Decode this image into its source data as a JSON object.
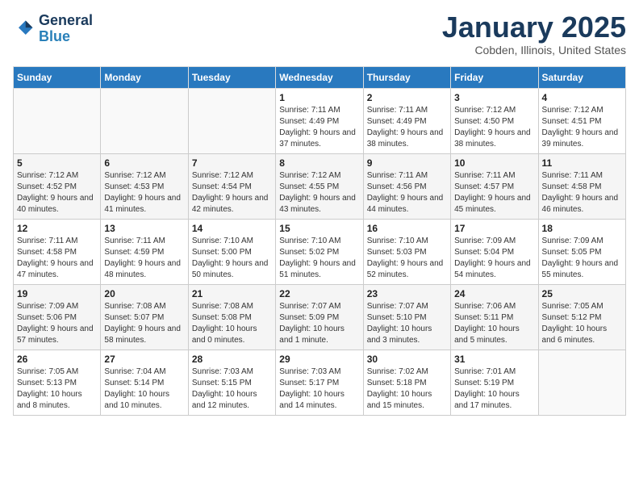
{
  "header": {
    "logo_line1": "General",
    "logo_line2": "Blue",
    "title": "January 2025",
    "subtitle": "Cobden, Illinois, United States"
  },
  "weekdays": [
    "Sunday",
    "Monday",
    "Tuesday",
    "Wednesday",
    "Thursday",
    "Friday",
    "Saturday"
  ],
  "weeks": [
    [
      {
        "day": "",
        "info": ""
      },
      {
        "day": "",
        "info": ""
      },
      {
        "day": "",
        "info": ""
      },
      {
        "day": "1",
        "info": "Sunrise: 7:11 AM\nSunset: 4:49 PM\nDaylight: 9 hours and 37 minutes."
      },
      {
        "day": "2",
        "info": "Sunrise: 7:11 AM\nSunset: 4:49 PM\nDaylight: 9 hours and 38 minutes."
      },
      {
        "day": "3",
        "info": "Sunrise: 7:12 AM\nSunset: 4:50 PM\nDaylight: 9 hours and 38 minutes."
      },
      {
        "day": "4",
        "info": "Sunrise: 7:12 AM\nSunset: 4:51 PM\nDaylight: 9 hours and 39 minutes."
      }
    ],
    [
      {
        "day": "5",
        "info": "Sunrise: 7:12 AM\nSunset: 4:52 PM\nDaylight: 9 hours and 40 minutes."
      },
      {
        "day": "6",
        "info": "Sunrise: 7:12 AM\nSunset: 4:53 PM\nDaylight: 9 hours and 41 minutes."
      },
      {
        "day": "7",
        "info": "Sunrise: 7:12 AM\nSunset: 4:54 PM\nDaylight: 9 hours and 42 minutes."
      },
      {
        "day": "8",
        "info": "Sunrise: 7:12 AM\nSunset: 4:55 PM\nDaylight: 9 hours and 43 minutes."
      },
      {
        "day": "9",
        "info": "Sunrise: 7:11 AM\nSunset: 4:56 PM\nDaylight: 9 hours and 44 minutes."
      },
      {
        "day": "10",
        "info": "Sunrise: 7:11 AM\nSunset: 4:57 PM\nDaylight: 9 hours and 45 minutes."
      },
      {
        "day": "11",
        "info": "Sunrise: 7:11 AM\nSunset: 4:58 PM\nDaylight: 9 hours and 46 minutes."
      }
    ],
    [
      {
        "day": "12",
        "info": "Sunrise: 7:11 AM\nSunset: 4:58 PM\nDaylight: 9 hours and 47 minutes."
      },
      {
        "day": "13",
        "info": "Sunrise: 7:11 AM\nSunset: 4:59 PM\nDaylight: 9 hours and 48 minutes."
      },
      {
        "day": "14",
        "info": "Sunrise: 7:10 AM\nSunset: 5:00 PM\nDaylight: 9 hours and 50 minutes."
      },
      {
        "day": "15",
        "info": "Sunrise: 7:10 AM\nSunset: 5:02 PM\nDaylight: 9 hours and 51 minutes."
      },
      {
        "day": "16",
        "info": "Sunrise: 7:10 AM\nSunset: 5:03 PM\nDaylight: 9 hours and 52 minutes."
      },
      {
        "day": "17",
        "info": "Sunrise: 7:09 AM\nSunset: 5:04 PM\nDaylight: 9 hours and 54 minutes."
      },
      {
        "day": "18",
        "info": "Sunrise: 7:09 AM\nSunset: 5:05 PM\nDaylight: 9 hours and 55 minutes."
      }
    ],
    [
      {
        "day": "19",
        "info": "Sunrise: 7:09 AM\nSunset: 5:06 PM\nDaylight: 9 hours and 57 minutes."
      },
      {
        "day": "20",
        "info": "Sunrise: 7:08 AM\nSunset: 5:07 PM\nDaylight: 9 hours and 58 minutes."
      },
      {
        "day": "21",
        "info": "Sunrise: 7:08 AM\nSunset: 5:08 PM\nDaylight: 10 hours and 0 minutes."
      },
      {
        "day": "22",
        "info": "Sunrise: 7:07 AM\nSunset: 5:09 PM\nDaylight: 10 hours and 1 minute."
      },
      {
        "day": "23",
        "info": "Sunrise: 7:07 AM\nSunset: 5:10 PM\nDaylight: 10 hours and 3 minutes."
      },
      {
        "day": "24",
        "info": "Sunrise: 7:06 AM\nSunset: 5:11 PM\nDaylight: 10 hours and 5 minutes."
      },
      {
        "day": "25",
        "info": "Sunrise: 7:05 AM\nSunset: 5:12 PM\nDaylight: 10 hours and 6 minutes."
      }
    ],
    [
      {
        "day": "26",
        "info": "Sunrise: 7:05 AM\nSunset: 5:13 PM\nDaylight: 10 hours and 8 minutes."
      },
      {
        "day": "27",
        "info": "Sunrise: 7:04 AM\nSunset: 5:14 PM\nDaylight: 10 hours and 10 minutes."
      },
      {
        "day": "28",
        "info": "Sunrise: 7:03 AM\nSunset: 5:15 PM\nDaylight: 10 hours and 12 minutes."
      },
      {
        "day": "29",
        "info": "Sunrise: 7:03 AM\nSunset: 5:17 PM\nDaylight: 10 hours and 14 minutes."
      },
      {
        "day": "30",
        "info": "Sunrise: 7:02 AM\nSunset: 5:18 PM\nDaylight: 10 hours and 15 minutes."
      },
      {
        "day": "31",
        "info": "Sunrise: 7:01 AM\nSunset: 5:19 PM\nDaylight: 10 hours and 17 minutes."
      },
      {
        "day": "",
        "info": ""
      }
    ]
  ]
}
